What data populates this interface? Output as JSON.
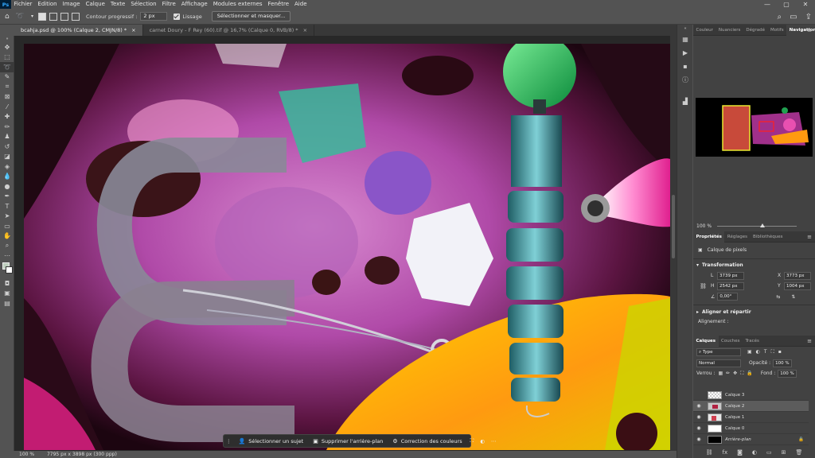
{
  "menu": {
    "logo": "Ps",
    "items": [
      "Fichier",
      "Edition",
      "Image",
      "Calque",
      "Texte",
      "Sélection",
      "Filtre",
      "Affichage",
      "Modules externes",
      "Fenêtre",
      "Aide"
    ]
  },
  "options": {
    "feather_label": "Contour progressif :",
    "feather_value": "2 px",
    "antialias_label": "Lissage",
    "select_mask_button": "Sélectionner et masquer..."
  },
  "tabs": [
    {
      "label": "bcahja.psd @ 100% (Calque 2, CMJN/8) *",
      "close": "×"
    },
    {
      "label": "carnet Doury - F Rey (60).tif @ 16,7% (Calque 0, RVB/8) *",
      "close": "×"
    }
  ],
  "status": {
    "zoom": "100 %",
    "dimensions": "7795 px x 3898 px (300 ppp)"
  },
  "context_bar": {
    "select_subject": "Sélectionner un sujet",
    "remove_background": "Supprimer l'arrière-plan",
    "color_correction": "Correction des couleurs"
  },
  "top_panel": {
    "tabs": [
      "Couleur",
      "Nuanciers",
      "Dégradé",
      "Motifs",
      "Navigation"
    ],
    "active": "Navigation",
    "zoom": "100 %"
  },
  "properties": {
    "tabs": [
      "Propriétés",
      "Réglages",
      "Bibliothèques"
    ],
    "active": "Propriétés",
    "layer_kind": "Calque de pixels",
    "transform_title": "Transformation",
    "L_label": "L",
    "L_value": "3739 px",
    "X_label": "X",
    "X_value": "3773 px",
    "H_label": "H",
    "H_value": "2542 px",
    "Y_label": "Y",
    "Y_value": "1004 px",
    "angle_value": "0,00°",
    "align_title": "Aligner et répartir",
    "align_label": "Alignement :"
  },
  "layers": {
    "tabs": [
      "Calques",
      "Couches",
      "Tracés"
    ],
    "active": "Calques",
    "filter": "Type",
    "blend_mode": "Normal",
    "opacity_label": "Opacité :",
    "opacity_value": "100 %",
    "lock_label": "Verrou :",
    "fill_label": "Fond :",
    "fill_value": "100 %",
    "items": [
      {
        "name": "Calque 3",
        "visible": false
      },
      {
        "name": "Calque 2",
        "visible": true,
        "selected": true
      },
      {
        "name": "Calque 1",
        "visible": true
      },
      {
        "name": "Calque 0",
        "visible": true
      },
      {
        "name": "Arrière-plan",
        "visible": true,
        "locked": true
      }
    ]
  },
  "colors": {
    "accent": "#31a8ff",
    "panel": "#424242",
    "chrome": "#535353"
  }
}
